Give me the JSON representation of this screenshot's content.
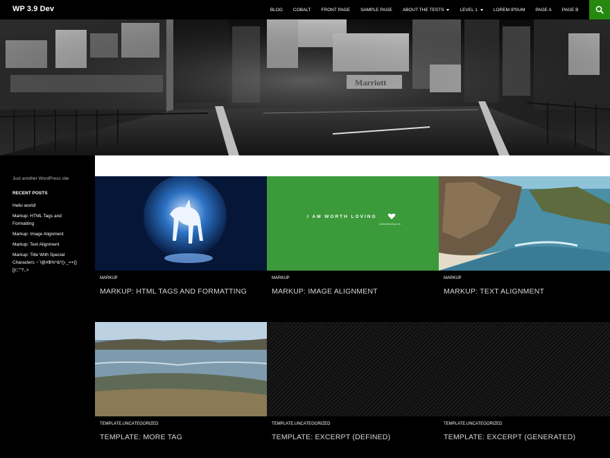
{
  "site": {
    "title": "WP 3.9 Dev",
    "tagline": "Just another WordPress site"
  },
  "nav": {
    "items": [
      {
        "label": "BLOG",
        "has_submenu": false
      },
      {
        "label": "COBALT",
        "has_submenu": false
      },
      {
        "label": "FRONT PAGE",
        "has_submenu": false
      },
      {
        "label": "SAMPLE PAGE",
        "has_submenu": false
      },
      {
        "label": "ABOUT THE TESTS",
        "has_submenu": true
      },
      {
        "label": "LEVEL 1",
        "has_submenu": true
      },
      {
        "label": "LOREM IPSUM",
        "has_submenu": false
      },
      {
        "label": "PAGE A",
        "has_submenu": false
      },
      {
        "label": "PAGE B",
        "has_submenu": false
      }
    ],
    "search_icon": "search-icon",
    "accent_color": "#24890d"
  },
  "sidebar": {
    "recent_posts_title": "RECENT POSTS",
    "recent_posts": [
      "Hello world!",
      "Markup: HTML Tags and Formatting",
      "Markup: Image Alignment",
      "Markup: Text Alignment",
      "Markup: Title With Special Characters ~`!@#$%^&*()-_=+{}[]/;:'\"?,.>"
    ]
  },
  "posts": [
    {
      "category": "MARKUP",
      "title": "MARKUP: HTML TAGS AND FORMATTING",
      "thumb": "unicorn"
    },
    {
      "category": "MARKUP",
      "title": "MARKUP: IMAGE ALIGNMENT",
      "thumb": "green",
      "thumb_text": "I AM WORTH LOVING",
      "thumb_subtext": "iamworthloving.com"
    },
    {
      "category": "MARKUP",
      "title": "MARKUP: TEXT ALIGNMENT",
      "thumb": "coast"
    },
    {
      "category": "TEMPLATE,UNCATEGORIZED",
      "title": "TEMPLATE: MORE TAG",
      "thumb": "water"
    },
    {
      "category": "TEMPLATE,UNCATEGORIZED",
      "title": "TEMPLATE: EXCERPT (DEFINED)",
      "thumb": "pattern"
    },
    {
      "category": "TEMPLATE,UNCATEGORIZED",
      "title": "TEMPLATE: EXCERPT (GENERATED)",
      "thumb": "none"
    }
  ]
}
